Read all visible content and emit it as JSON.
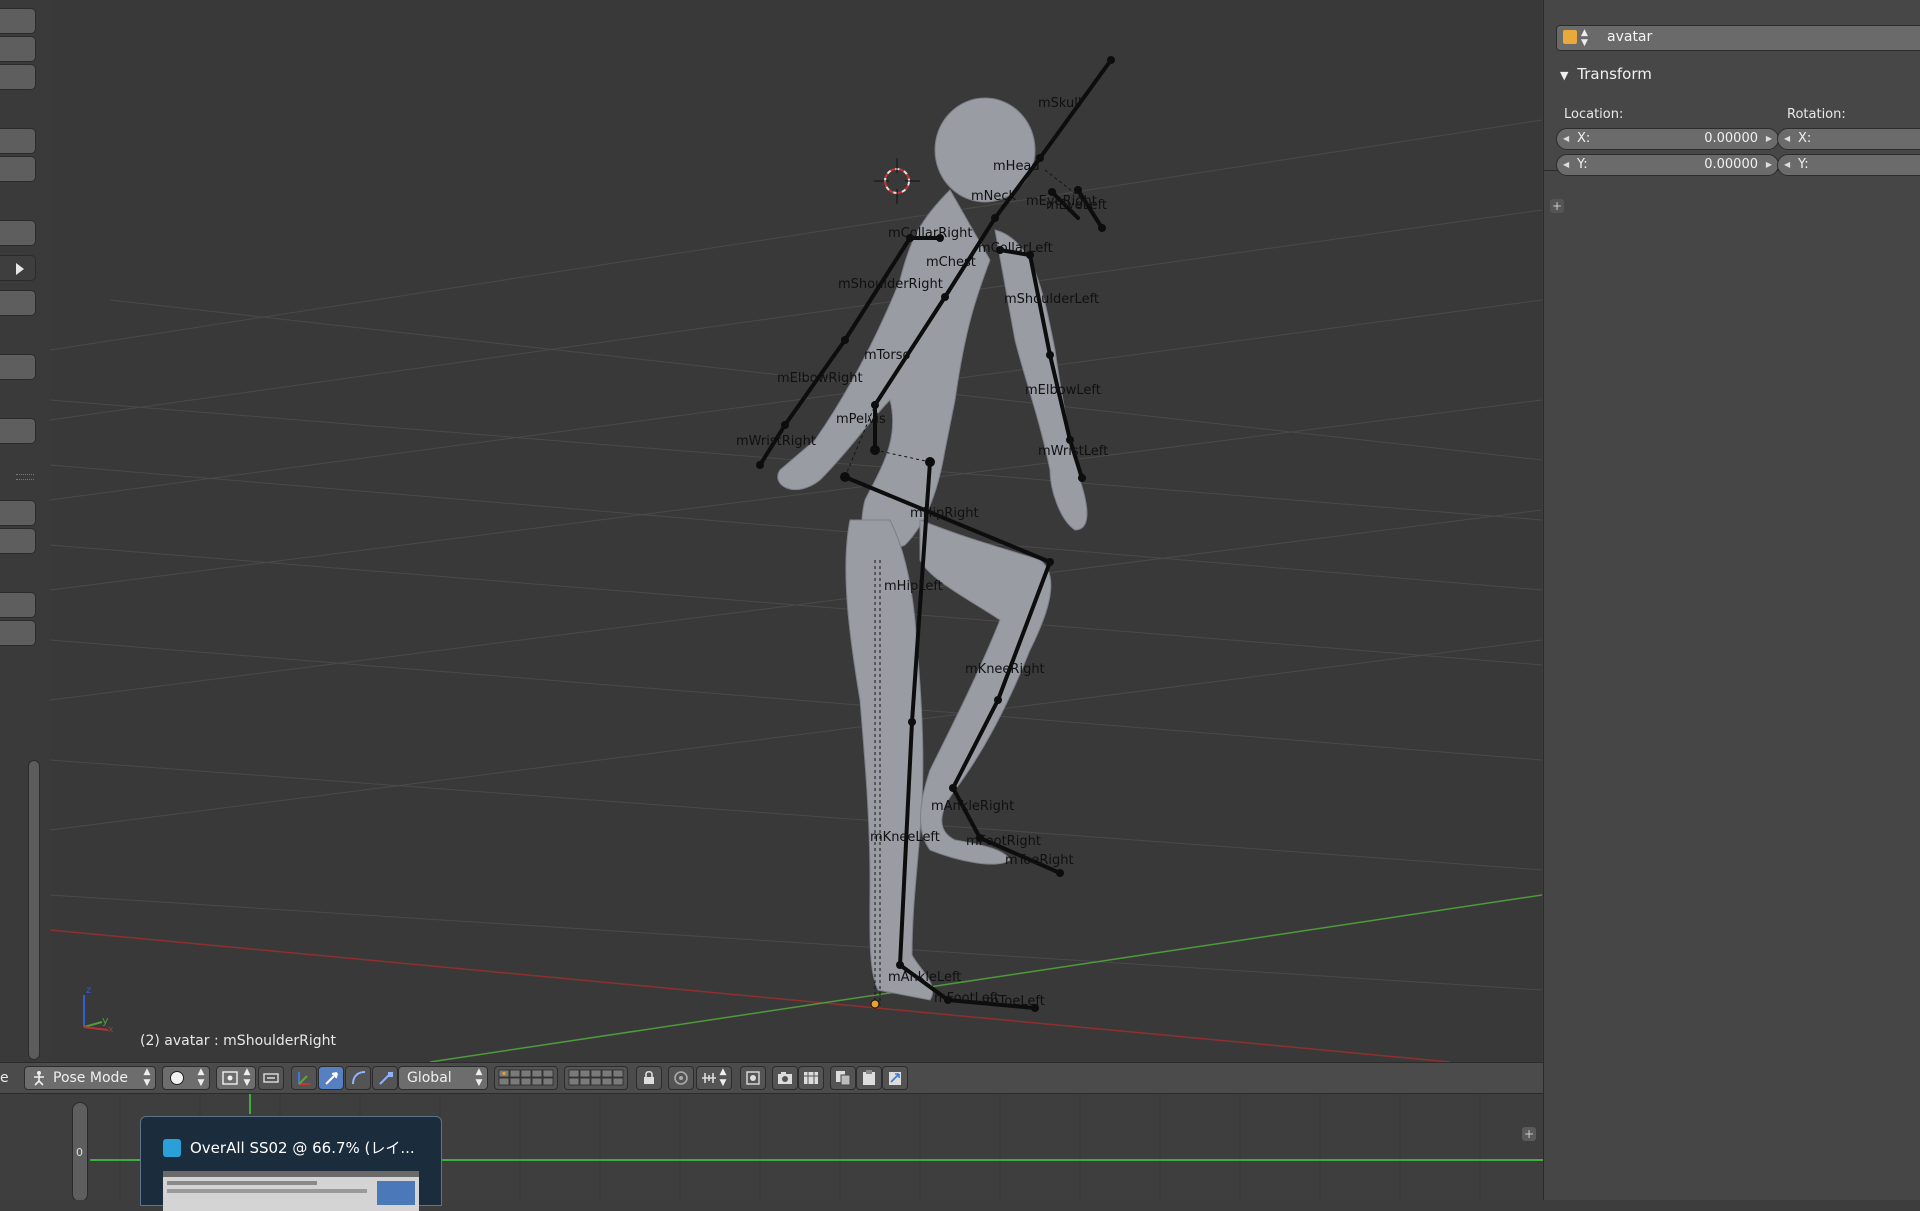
{
  "viewport": {
    "status": "(2) avatar : mShoulderRight",
    "axes": {
      "x": "x",
      "y": "y",
      "z": "z"
    },
    "bone_labels": [
      {
        "text": "mSkull"
      },
      {
        "text": "mHead"
      },
      {
        "text": "mNeck"
      },
      {
        "text": "mEyeRight"
      },
      {
        "text": "mEyeLeft"
      },
      {
        "text": "mCollarRight"
      },
      {
        "text": "mCollarLeft"
      },
      {
        "text": "mChest"
      },
      {
        "text": "mShoulderRight"
      },
      {
        "text": "mShoulderLeft"
      },
      {
        "text": "mTorso"
      },
      {
        "text": "mElbowRight"
      },
      {
        "text": "mElbowLeft"
      },
      {
        "text": "mPelvis"
      },
      {
        "text": "mWristRight"
      },
      {
        "text": "mWristLeft"
      },
      {
        "text": "mHipRight"
      },
      {
        "text": "mHipLeft"
      },
      {
        "text": "mKneeRight"
      },
      {
        "text": "mAnkleRight"
      },
      {
        "text": "mKneeLeft"
      },
      {
        "text": "mFootRight"
      },
      {
        "text": "mToeRight"
      },
      {
        "text": "mAnkleLeft"
      },
      {
        "text": "mFootLeft"
      },
      {
        "text": "mToeLeft"
      }
    ]
  },
  "header": {
    "editor_type_partial": "e",
    "mode": "Pose Mode",
    "orientation": "Global",
    "icons": [
      "pose-icon",
      "shading-sphere-icon",
      "pivot-icon",
      "manipulator-icon",
      "translate-icon",
      "rotate-icon",
      "scale-icon",
      "layer-icon",
      "lock-icon",
      "snap-icon",
      "magnet-icon",
      "render-icon",
      "camera-icon",
      "copy-pose-icon",
      "paste-pose-icon",
      "paste-flipped-icon"
    ]
  },
  "timeline": {
    "frame_label": "0"
  },
  "taskbar_popup": {
    "title": "OverAll SS02 @ 66.7% (レイ..."
  },
  "properties": {
    "object_name": "avatar",
    "panel_title": "Transform",
    "location_label": "Location:",
    "rotation_label": "Rotation:",
    "location_x": {
      "axis": "X:",
      "value": "0.00000"
    },
    "location_y": {
      "axis": "Y:",
      "value": "0.00000"
    },
    "rotation_x": {
      "axis": "X:"
    },
    "rotation_y": {
      "axis": "Y:"
    }
  },
  "colors": {
    "viewport_bg": "#393939",
    "grid": "#4a4a4a",
    "x_axis": "#8f3030",
    "y_axis": "#4f9a3a",
    "selected_button": "#5680c2",
    "origin": "#e8a030"
  }
}
